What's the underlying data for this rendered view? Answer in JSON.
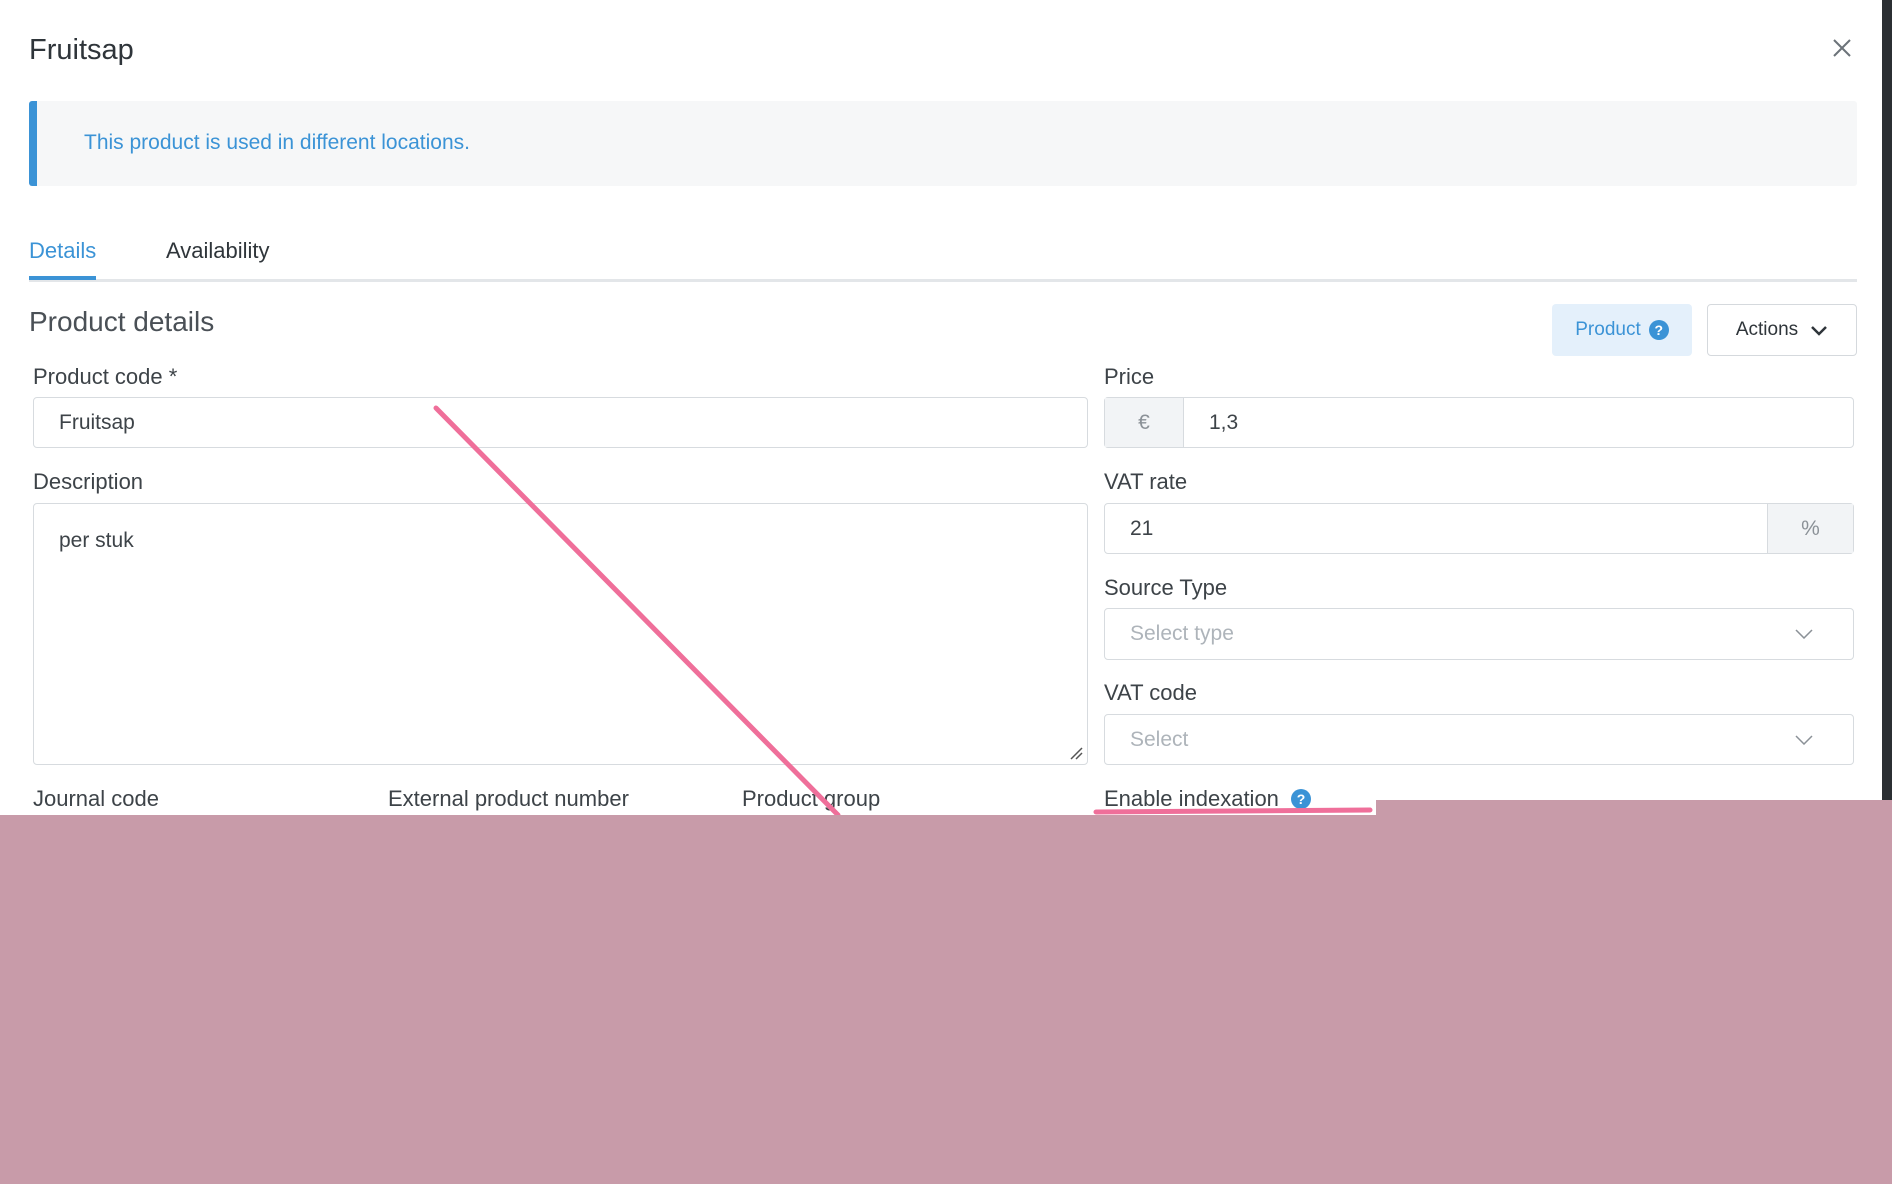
{
  "modal": {
    "title": "Fruitsap"
  },
  "callout": {
    "text": "This product is used in different locations."
  },
  "tabs": [
    {
      "label": "Details",
      "active": true
    },
    {
      "label": "Availability",
      "active": false
    }
  ],
  "section": {
    "title": "Product details"
  },
  "header_buttons": {
    "product_label": "Product",
    "actions_label": "Actions"
  },
  "form": {
    "product_code": {
      "label": "Product code *",
      "value": "Fruitsap"
    },
    "description": {
      "label": "Description",
      "value": "per stuk"
    },
    "price": {
      "label": "Price",
      "currency": "€",
      "value": "1,3"
    },
    "vat_rate": {
      "label": "VAT rate",
      "value": "21",
      "unit": "%"
    },
    "source_type": {
      "label": "Source Type",
      "placeholder": "Select type"
    },
    "vat_code": {
      "label": "VAT code",
      "placeholder": "Select"
    },
    "journal_code": {
      "label": "Journal code"
    },
    "external_product_number": {
      "label": "External product number"
    },
    "product_group": {
      "label": "Product group"
    },
    "enable_indexation": {
      "label": "Enable indexation"
    }
  },
  "colors": {
    "accent": "#3b93d6",
    "annotation": "#ef6f9a",
    "cover": "#c89ba9"
  },
  "icons": [
    "close-icon",
    "help-icon",
    "chevron-down-icon",
    "resize-grip-icon"
  ]
}
